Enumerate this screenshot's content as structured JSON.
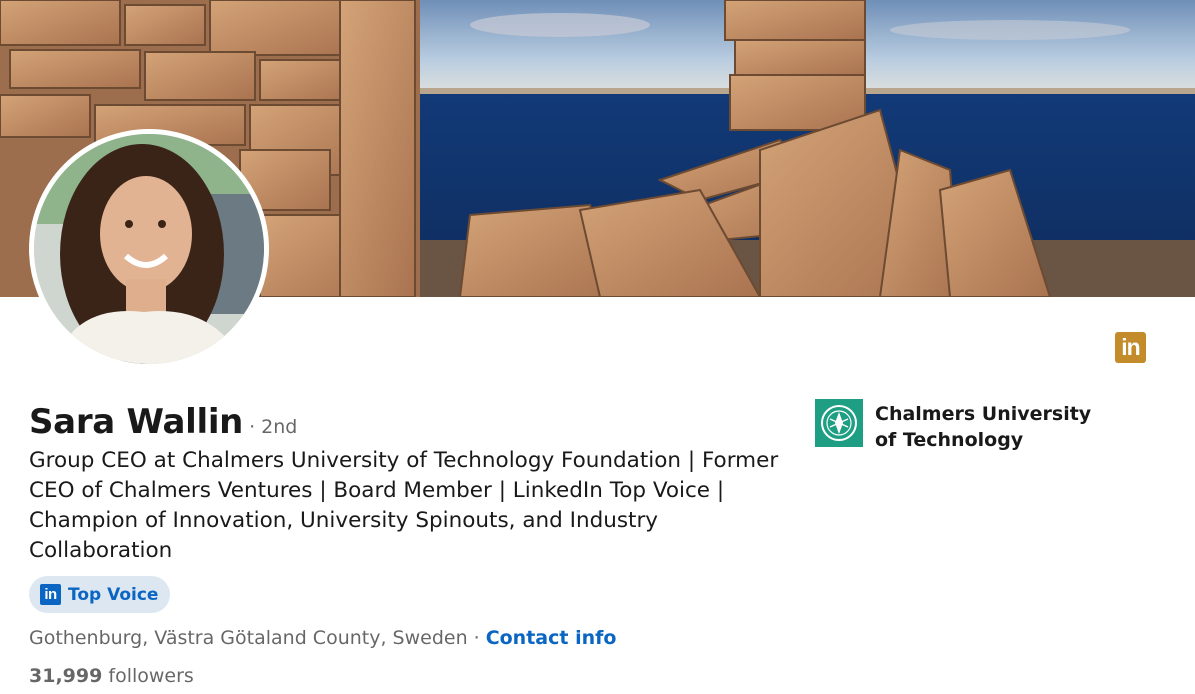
{
  "profile": {
    "name": "Sara Wallin",
    "degree": "· 2nd",
    "headline": "Group CEO at Chalmers University of Technology Foundation | Former CEO of Chalmers Ventures | Board Member | LinkedIn Top Voice | Champion of Innovation, University Spinouts, and Industry Collaboration",
    "location": "Gothenburg, Västra Götaland County, Sweden",
    "separator": "·",
    "contact_label": "Contact info",
    "followers_count": "31,999",
    "followers_label": "followers"
  },
  "badge": {
    "icon": "linkedin-icon",
    "icon_text": "in",
    "label": "Top Voice"
  },
  "premium_icon": {
    "icon": "linkedin-premium-icon",
    "text": "in"
  },
  "organization": {
    "name": "Chalmers University of Technology",
    "logo_icon": "chalmers-logo-icon"
  },
  "colors": {
    "brand_blue": "#0a66c2",
    "premium_gold": "#c38b2a",
    "badge_bg": "#dde7f1",
    "chalmers_green": "#1e9e82"
  }
}
